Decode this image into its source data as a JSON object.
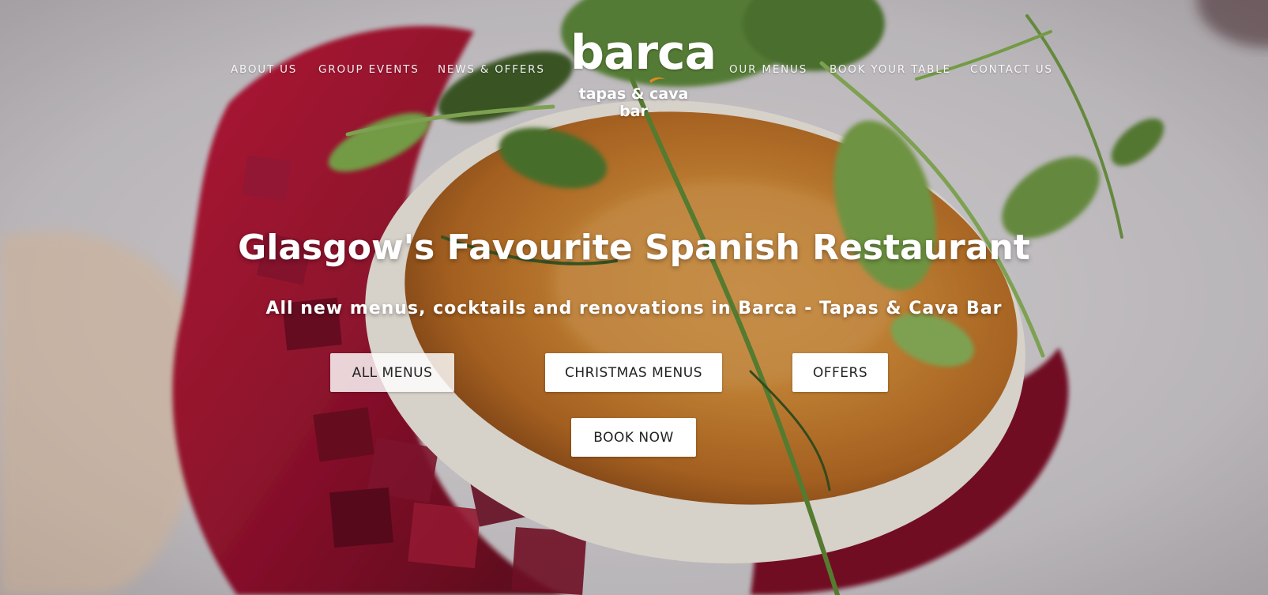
{
  "nav": {
    "left": [
      "ABOUT US",
      "GROUP EVENTS",
      "NEWS & OFFERS"
    ],
    "right": [
      "OUR MENUS",
      "BOOK YOUR TABLE",
      "CONTACT US"
    ]
  },
  "logo": {
    "name": "barca",
    "tagline": "tapas & cava bar"
  },
  "hero": {
    "title": "Glasgow's Favourite Spanish Restaurant",
    "subtitle": "All new menus, cocktails and renovations in Barca - Tapas & Cava Bar"
  },
  "buttons": {
    "all_menus": "ALL MENUS",
    "christmas_menus": "CHRISTMAS MENUS",
    "offers": "OFFERS",
    "book_now": "BOOK NOW"
  },
  "colors": {
    "text": "#ffffff",
    "button_bg": "#ffffff",
    "button_text": "#222222",
    "logo_accent": "#e08a1e"
  },
  "background_image": "food-photo"
}
